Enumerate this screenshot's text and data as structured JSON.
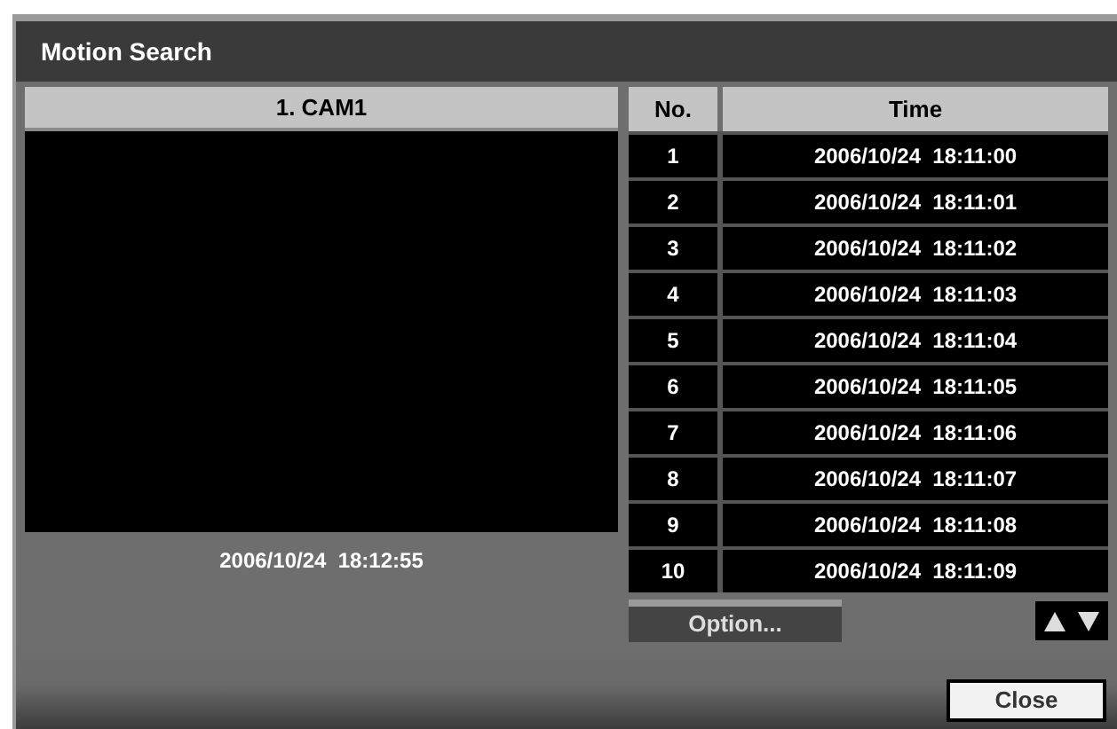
{
  "window": {
    "title": "Motion Search"
  },
  "camera": {
    "title": "1. CAM1",
    "timestamp": "2006/10/24  18:12:55"
  },
  "table": {
    "columns": [
      "No.",
      "Time"
    ],
    "rows": [
      {
        "no": "1",
        "time": "2006/10/24  18:11:00"
      },
      {
        "no": "2",
        "time": "2006/10/24  18:11:01"
      },
      {
        "no": "3",
        "time": "2006/10/24  18:11:02"
      },
      {
        "no": "4",
        "time": "2006/10/24  18:11:03"
      },
      {
        "no": "5",
        "time": "2006/10/24  18:11:04"
      },
      {
        "no": "6",
        "time": "2006/10/24  18:11:05"
      },
      {
        "no": "7",
        "time": "2006/10/24  18:11:06"
      },
      {
        "no": "8",
        "time": "2006/10/24  18:11:07"
      },
      {
        "no": "9",
        "time": "2006/10/24  18:11:08"
      },
      {
        "no": "10",
        "time": "2006/10/24  18:11:09"
      }
    ]
  },
  "buttons": {
    "option": "Option...",
    "close": "Close"
  }
}
